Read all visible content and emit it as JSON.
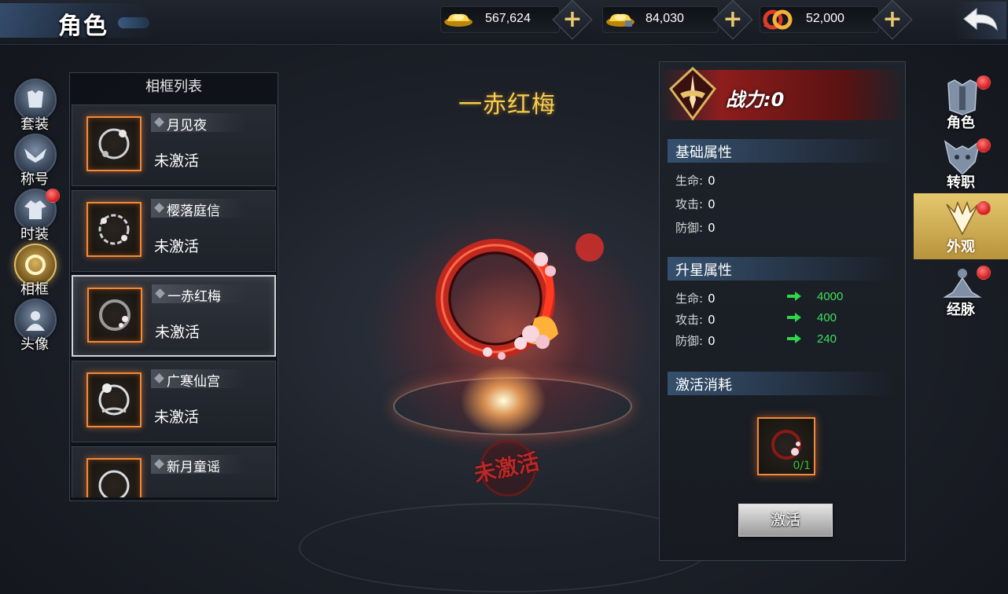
{
  "header": {
    "title": "角色",
    "currencies": [
      {
        "icon": "gold-ingot-icon",
        "value": "567,624"
      },
      {
        "icon": "bound-gold-ingot-icon",
        "value": "84,030"
      },
      {
        "icon": "copper-coins-icon",
        "value": "52,000"
      }
    ],
    "plus_label": "+",
    "back_icon": "back-arrow-icon"
  },
  "left_categories": [
    {
      "label": "套装",
      "icon": "armor-icon",
      "badge": false
    },
    {
      "label": "称号",
      "icon": "wings-icon",
      "badge": false
    },
    {
      "label": "时装",
      "icon": "robe-icon",
      "badge": true
    },
    {
      "label": "相框",
      "icon": "frame-ring-icon",
      "badge": false,
      "active": true
    },
    {
      "label": "头像",
      "icon": "portrait-icon",
      "badge": false
    }
  ],
  "frame_list": {
    "header": "相框列表",
    "items": [
      {
        "name": "月见夜",
        "status": "未激活",
        "selected": false
      },
      {
        "name": "樱落庭信",
        "status": "未激活",
        "selected": false
      },
      {
        "name": "一赤红梅",
        "status": "未激活",
        "selected": true
      },
      {
        "name": "广寒仙宫",
        "status": "未激活",
        "selected": false
      },
      {
        "name": "新月童谣",
        "status": "",
        "selected": false
      }
    ]
  },
  "showcase": {
    "title": "一赤红梅",
    "stamp": "未激活"
  },
  "info": {
    "power": "战力:0",
    "base_header": "基础属性",
    "base_stats": [
      {
        "label": "生命:",
        "value": "0"
      },
      {
        "label": "攻击:",
        "value": "0"
      },
      {
        "label": "防御:",
        "value": "0"
      }
    ],
    "star_header": "升星属性",
    "star_stats": [
      {
        "label": "生命:",
        "value": "0",
        "next": "4000"
      },
      {
        "label": "攻击:",
        "value": "0",
        "next": "400"
      },
      {
        "label": "防御:",
        "value": "0",
        "next": "240"
      }
    ],
    "cost_header": "激活消耗",
    "cost_count": "0/1",
    "activate_label": "激活"
  },
  "right_nav": [
    {
      "label": "角色",
      "icon": "helmet-icon",
      "badge": true,
      "active": false
    },
    {
      "label": "转职",
      "icon": "demon-mask-icon",
      "badge": true,
      "active": false
    },
    {
      "label": "外观",
      "icon": "phoenix-wings-icon",
      "badge": true,
      "active": true
    },
    {
      "label": "经脉",
      "icon": "meditation-icon",
      "badge": true,
      "active": false
    }
  ],
  "colors": {
    "gold_title": "#f4cf4f",
    "stat_green": "#3fe05c",
    "frame_orange": "#f08a3a",
    "badge_red": "#d11c1c"
  }
}
